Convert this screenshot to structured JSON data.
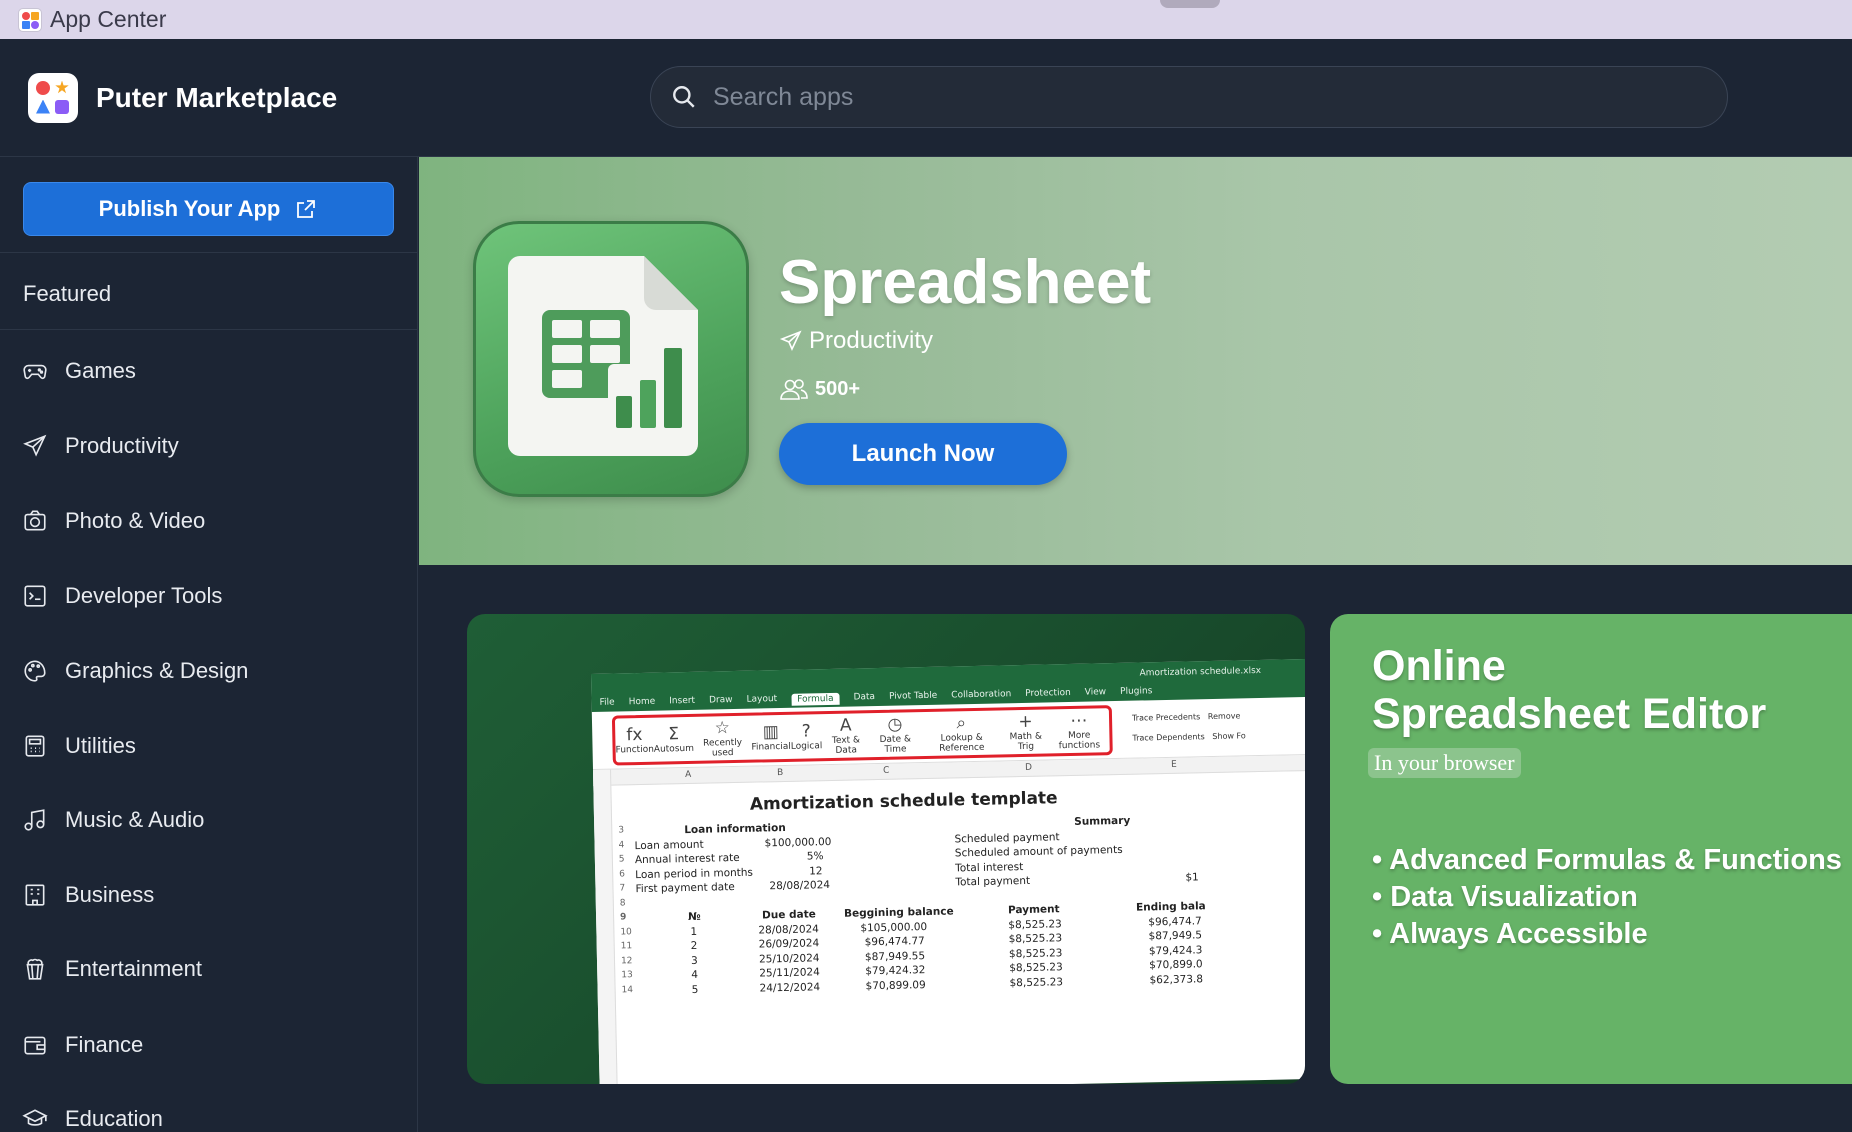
{
  "os_bar": {
    "title": "App Center"
  },
  "header": {
    "brand": "Puter Marketplace",
    "search": {
      "placeholder": "Search apps",
      "value": ""
    }
  },
  "sidebar": {
    "publish_label": "Publish Your App",
    "featured_label": "Featured",
    "categories": [
      {
        "label": "Games",
        "icon": "gamepad-icon"
      },
      {
        "label": "Productivity",
        "icon": "paper-plane-icon"
      },
      {
        "label": "Photo & Video",
        "icon": "camera-icon"
      },
      {
        "label": "Developer Tools",
        "icon": "terminal-icon"
      },
      {
        "label": "Graphics & Design",
        "icon": "palette-icon"
      },
      {
        "label": "Utilities",
        "icon": "calculator-icon"
      },
      {
        "label": "Music & Audio",
        "icon": "music-note-icon"
      },
      {
        "label": "Business",
        "icon": "building-icon"
      },
      {
        "label": "Entertainment",
        "icon": "popcorn-icon"
      },
      {
        "label": "Finance",
        "icon": "wallet-icon"
      },
      {
        "label": "Education",
        "icon": "graduation-cap-icon"
      }
    ]
  },
  "hero": {
    "app_name": "Spreadsheet",
    "category": "Productivity",
    "users": "500+",
    "launch_label": "Launch Now",
    "colors": {
      "accent": "#1d6fd8",
      "hero_bg": "#96ba96"
    }
  },
  "screenshot1": {
    "file_name": "Amortization schedule.xlsx",
    "tabs": [
      "File",
      "Home",
      "Insert",
      "Draw",
      "Layout",
      "Formula",
      "Data",
      "Pivot Table",
      "Collaboration",
      "Protection",
      "View",
      "Plugins"
    ],
    "active_tab": "Formula",
    "ribbon": [
      {
        "glyph": "fx",
        "label": "Function"
      },
      {
        "glyph": "Σ",
        "label": "Autosum"
      },
      {
        "glyph": "☆",
        "label": "Recently used"
      },
      {
        "glyph": "▥",
        "label": "Financial"
      },
      {
        "glyph": "?",
        "label": "Logical"
      },
      {
        "glyph": "A",
        "label": "Text & Data"
      },
      {
        "glyph": "◷",
        "label": "Date & Time"
      },
      {
        "glyph": "⌕",
        "label": "Lookup & Reference"
      },
      {
        "glyph": "+",
        "label": "Math & Trig"
      },
      {
        "glyph": "⋯",
        "label": "More functions"
      }
    ],
    "ribbon_side": [
      "Trace Precedents",
      "Trace Dependents",
      "Remove",
      "Show Fo"
    ],
    "columns": [
      "A",
      "B",
      "C",
      "D",
      "E"
    ],
    "doc_title": "Amortization schedule template",
    "loan_info_title": "Loan information",
    "summary_title": "Summary",
    "loan_rows": [
      {
        "label": "Loan amount",
        "value": "$100,000.00"
      },
      {
        "label": "Annual interest rate",
        "value": "5%"
      },
      {
        "label": "Loan period in months",
        "value": "12"
      },
      {
        "label": "First payment date",
        "value": "28/08/2024"
      }
    ],
    "summary_rows": [
      "Scheduled payment",
      "Scheduled amount of payments",
      "Total interest",
      "Total payment"
    ],
    "summary_last_value": "$1",
    "table_headers": [
      "№",
      "Due date",
      "Beggining balance",
      "Payment",
      "Ending bala"
    ],
    "table_rows": [
      [
        "1",
        "28/08/2024",
        "$105,000.00",
        "$8,525.23",
        "$96,474.7"
      ],
      [
        "2",
        "26/09/2024",
        "$96,474.77",
        "$8,525.23",
        "$87,949.5"
      ],
      [
        "3",
        "25/10/2024",
        "$87,949.55",
        "$8,525.23",
        "$79,424.3"
      ],
      [
        "4",
        "25/11/2024",
        "$79,424.32",
        "$8,525.23",
        "$70,899.0"
      ],
      [
        "5",
        "24/12/2024",
        "$70,899.09",
        "$8,525.23",
        "$62,373.8"
      ]
    ]
  },
  "screenshot2": {
    "title_line1": "Online",
    "title_line2": "Spreadsheet Editor",
    "subtitle": "In your browser",
    "features": [
      "• Advanced Formulas & Functions",
      "• Data Visualization",
      "• Always Accessible"
    ]
  }
}
